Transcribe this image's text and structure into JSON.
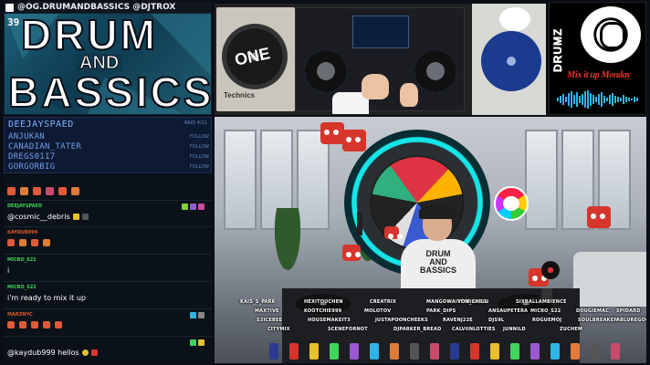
{
  "social": {
    "text": "@OG.DRUMANDBASSICS @DJTROX"
  },
  "logo": {
    "number": "39",
    "line1": "DRUM",
    "line2": "AND",
    "line3": "BASSICS"
  },
  "turntable": {
    "left_label": "Technics",
    "left_sticker": "ONE"
  },
  "promo": {
    "vertical": "DRUMZ",
    "tagline": "Mix it up Monday"
  },
  "followers": {
    "header": "DEEJAYSPAED",
    "raid_label": "RAID 4/11",
    "follow_label": "FOLLOW",
    "items": [
      "ANJUKAN",
      "CANADIAN_TATER",
      "DREGS0117",
      "GORGORBIG"
    ]
  },
  "chat": {
    "messages": [
      {
        "user": "DEEJAYSPAED",
        "text": "@cosmic__debris",
        "user_color": "#3fd45a"
      },
      {
        "user": "KAYDUB999",
        "text": "",
        "user_color": "#d85a2a"
      },
      {
        "user": "MICRO_S22",
        "text": "i",
        "user_color": "#3fd45a"
      },
      {
        "user": "MICRO_S22",
        "text": "i'm ready to mix it up",
        "user_color": "#3fd45a"
      },
      {
        "user": "MARZNYC",
        "text": "",
        "user_color": "#d85a2a"
      },
      {
        "user": "",
        "text": "@kaydub999 hellos",
        "user_color": "#3fd45a"
      }
    ]
  },
  "shirt": {
    "text": "DRUM AND BASSICS"
  },
  "ticker": {
    "names": [
      "KAIS_S_PARK",
      "HEXITOUCHEN",
      "CREATRIX",
      "MANGOWAITFORANTIN",
      "VON_CHILL",
      "SIXBALLAMBIENCE",
      "MAXTIVE",
      "KOOTCHIE999",
      "MOLOTOV",
      "PARK_DIPS",
      "ANSAUPETERA",
      "MICRO_S22",
      "DOUGIEMAC",
      "SPIDARD",
      "S3ICEBEE",
      "HOUSEMAKEIT3",
      "JUSTAPOONCHEEKS",
      "RAVENJ22E",
      "DJS9L",
      "ROGUEMOJ",
      "SOULBREAKER",
      "ABLUREGOO",
      "CITYMIX",
      "SCENEFORNOT",
      "DJPARKER_BREAD",
      "CALVIINLOTTIES",
      "JUNNILD",
      "ZUCHEM"
    ]
  },
  "colors": {
    "accent": "#2fb4e6",
    "portal": "#15e4e8",
    "follow_bg": "#0e1a33",
    "chat_bg": "#0b1118"
  }
}
